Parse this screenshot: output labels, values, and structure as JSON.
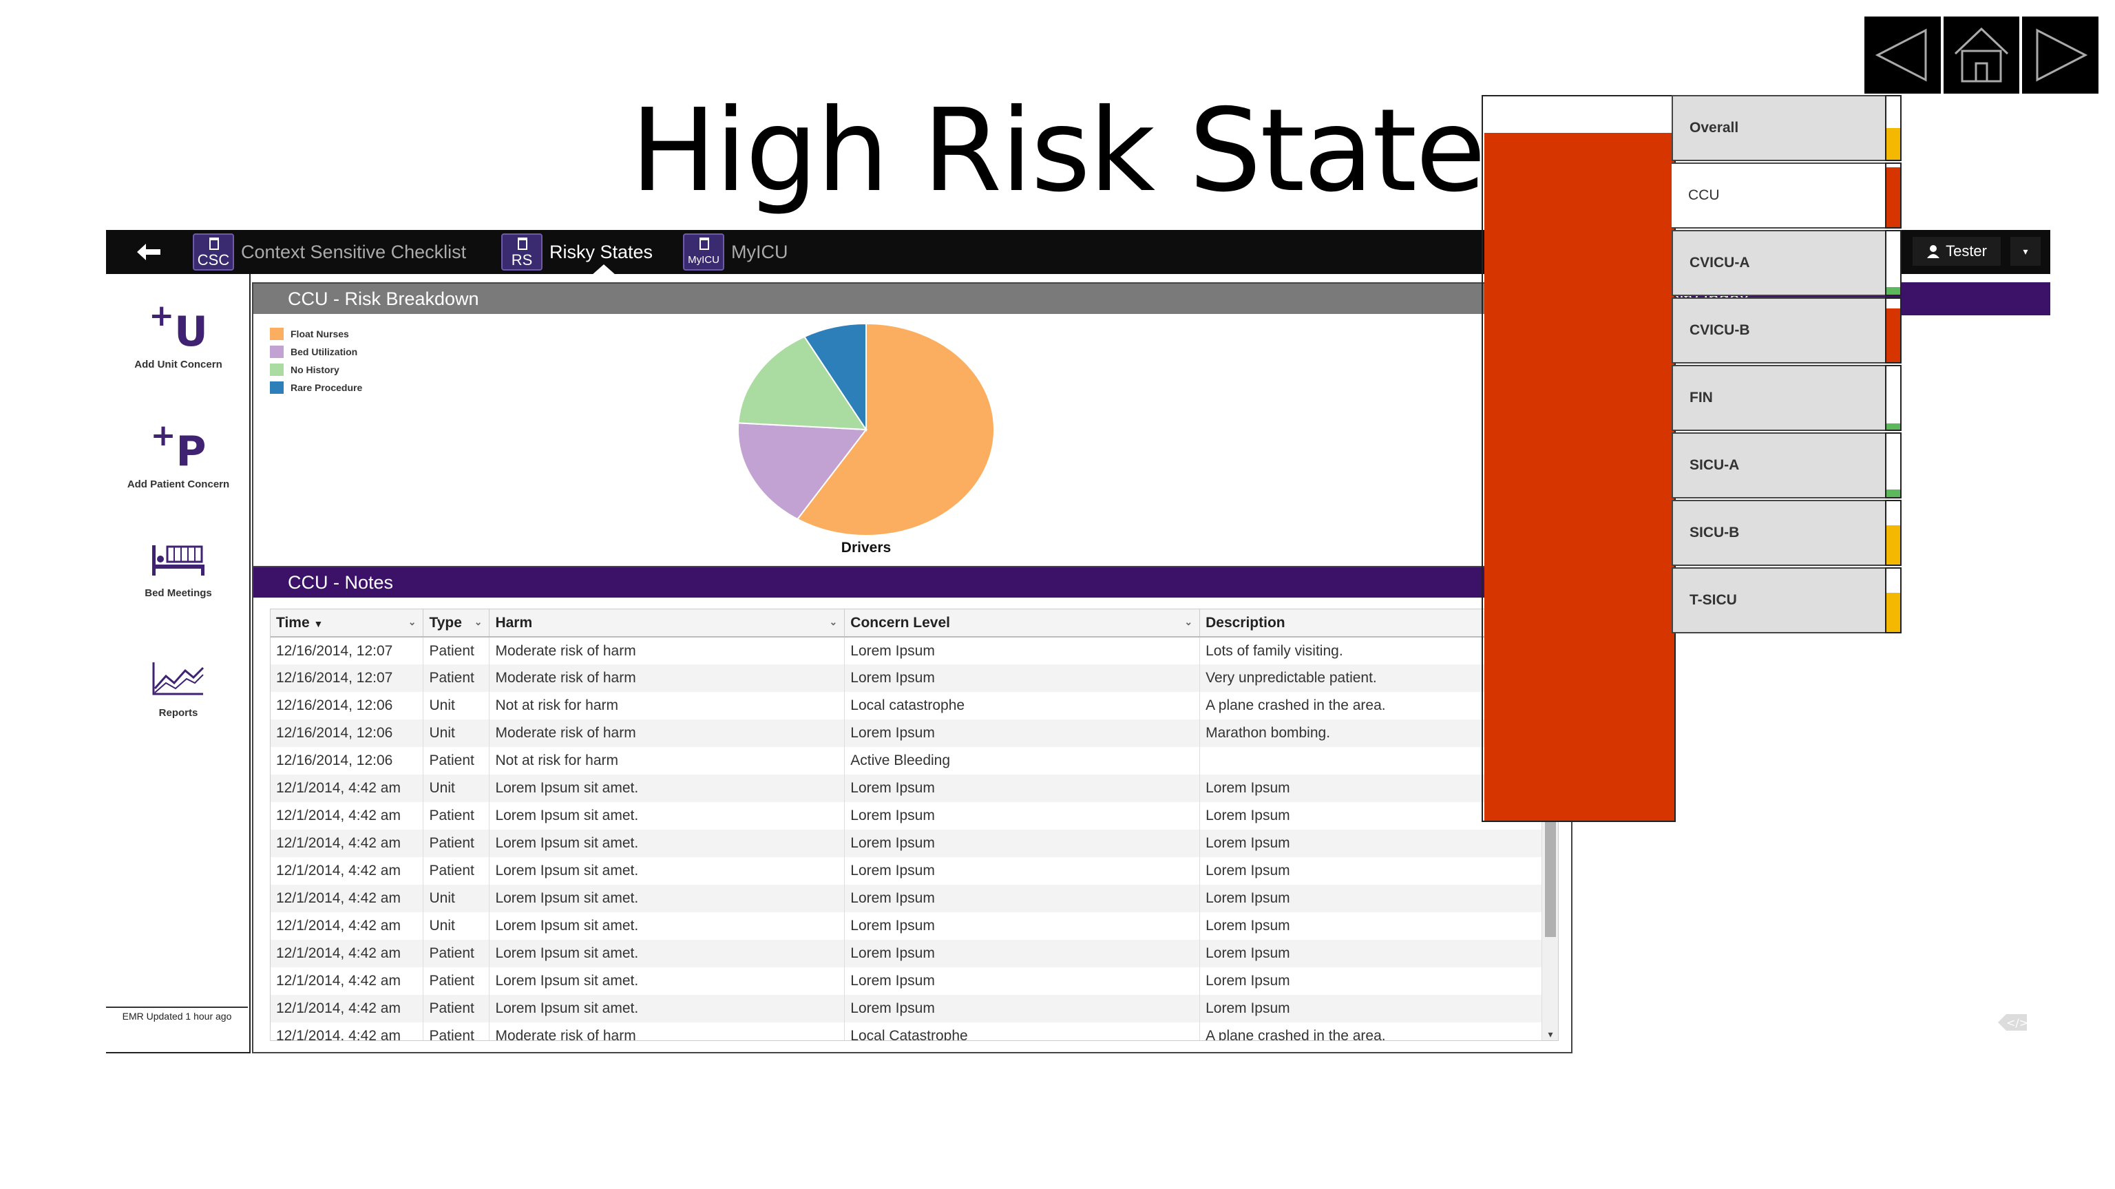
{
  "slide": {
    "title": "High Risk State"
  },
  "colors": {
    "topbar": "#0d0d0d",
    "purple_header": "#3b1268",
    "gray_header": "#7a7a7a",
    "icu_bar": "#d63500",
    "status_red": "#d63500",
    "status_yellow": "#f5b800",
    "status_green": "#5db85c"
  },
  "topbar": {
    "back_icon": "back-arrow-icon",
    "tabs": [
      {
        "icon_text": "CSC",
        "label": "Context Sensitive Checklist",
        "active": false
      },
      {
        "icon_text": "RS",
        "label": "Risky States",
        "active": true
      },
      {
        "icon_text": "MyICU",
        "label": "MyICU",
        "active": false
      }
    ],
    "user": {
      "icon": "user-icon",
      "name": "Tester"
    }
  },
  "sidebar": {
    "items": [
      {
        "glyph": "U",
        "label": "Add Unit Concern",
        "icon": "add-unit-concern-icon"
      },
      {
        "glyph": "P",
        "label": "Add Patient Concern",
        "icon": "add-patient-concern-icon"
      },
      {
        "label": "Bed Meetings",
        "icon": "bed-icon"
      },
      {
        "label": "Reports",
        "icon": "reports-chart-icon"
      }
    ],
    "emr_updated": "EMR Updated 1 hour ago"
  },
  "risk_panel": {
    "title": "CCU - Risk Breakdown",
    "pie_label": "Drivers"
  },
  "chart_data": {
    "type": "pie",
    "title": "",
    "xlabel": "Drivers",
    "legend": "top-left",
    "categories": [
      "Float Nurses",
      "Bed Utilization",
      "No History",
      "Rare Procedure"
    ],
    "values": [
      59,
      17,
      16,
      8
    ],
    "colors": [
      "#fbae60",
      "#c2a2d2",
      "#aadca2",
      "#2d7fba"
    ]
  },
  "notes_panel": {
    "title": "CCU - Notes",
    "columns": [
      "Time",
      "Type",
      "Harm",
      "Concern Level",
      "Description"
    ],
    "rows": [
      [
        "12/16/2014, 12:07",
        "Patient",
        "Moderate risk of harm",
        "Lorem Ipsum",
        "Lots of family visiting."
      ],
      [
        "12/16/2014, 12:07",
        "Patient",
        "Moderate risk of harm",
        "Lorem Ipsum",
        "Very unpredictable patient."
      ],
      [
        "12/16/2014, 12:06",
        "Unit",
        "Not at risk for harm",
        "Local catastrophe",
        "A plane crashed in the area."
      ],
      [
        "12/16/2014, 12:06",
        "Unit",
        "Moderate risk of harm",
        "Lorem Ipsum",
        "Marathon bombing."
      ],
      [
        "12/16/2014, 12:06",
        "Patient",
        "Not at risk for harm",
        "Active Bleeding",
        ""
      ],
      [
        "12/1/2014, 4:42 am",
        "Unit",
        "Lorem Ipsum sit amet.",
        "Lorem Ipsum",
        "Lorem Ipsum"
      ],
      [
        "12/1/2014, 4:42 am",
        "Patient",
        "Lorem Ipsum sit amet.",
        "Lorem Ipsum",
        "Lorem Ipsum"
      ],
      [
        "12/1/2014, 4:42 am",
        "Patient",
        "Lorem Ipsum sit amet.",
        "Lorem Ipsum",
        "Lorem Ipsum"
      ],
      [
        "12/1/2014, 4:42 am",
        "Patient",
        "Lorem Ipsum sit amet.",
        "Lorem Ipsum",
        "Lorem Ipsum"
      ],
      [
        "12/1/2014, 4:42 am",
        "Unit",
        "Lorem Ipsum sit amet.",
        "Lorem Ipsum",
        "Lorem Ipsum"
      ],
      [
        "12/1/2014, 4:42 am",
        "Unit",
        "Lorem Ipsum sit amet.",
        "Lorem Ipsum",
        "Lorem Ipsum"
      ],
      [
        "12/1/2014, 4:42 am",
        "Patient",
        "Lorem Ipsum sit amet.",
        "Lorem Ipsum",
        "Lorem Ipsum"
      ],
      [
        "12/1/2014, 4:42 am",
        "Patient",
        "Lorem Ipsum sit amet.",
        "Lorem Ipsum",
        "Lorem Ipsum"
      ],
      [
        "12/1/2014, 4:42 am",
        "Patient",
        "Lorem Ipsum sit amet.",
        "Lorem Ipsum",
        "Lorem Ipsum"
      ],
      [
        "12/1/2014, 4:42 am",
        "Patient",
        "Moderate risk of harm",
        "Local Catastrophe",
        "A plane crashed in the area."
      ]
    ]
  },
  "icu_index": {
    "title": "ICU Intensity Index",
    "overall_level": 0.95,
    "units": [
      {
        "name": "Overall",
        "selected": false,
        "status": "yellow",
        "level": 0.5
      },
      {
        "name": "CCU",
        "selected": true,
        "status": "red",
        "level": 0.95
      },
      {
        "name": "CVICU-A",
        "selected": false,
        "status": "green",
        "level": 0.12
      },
      {
        "name": "CVICU-B",
        "selected": false,
        "status": "red",
        "level": 0.85
      },
      {
        "name": "FIN",
        "selected": false,
        "status": "green",
        "level": 0.1
      },
      {
        "name": "SICU-A",
        "selected": false,
        "status": "green",
        "level": 0.12
      },
      {
        "name": "SICU-B",
        "selected": false,
        "status": "yellow",
        "level": 0.62
      },
      {
        "name": "T-SICU",
        "selected": false,
        "status": "yellow",
        "level": 0.62
      }
    ]
  }
}
